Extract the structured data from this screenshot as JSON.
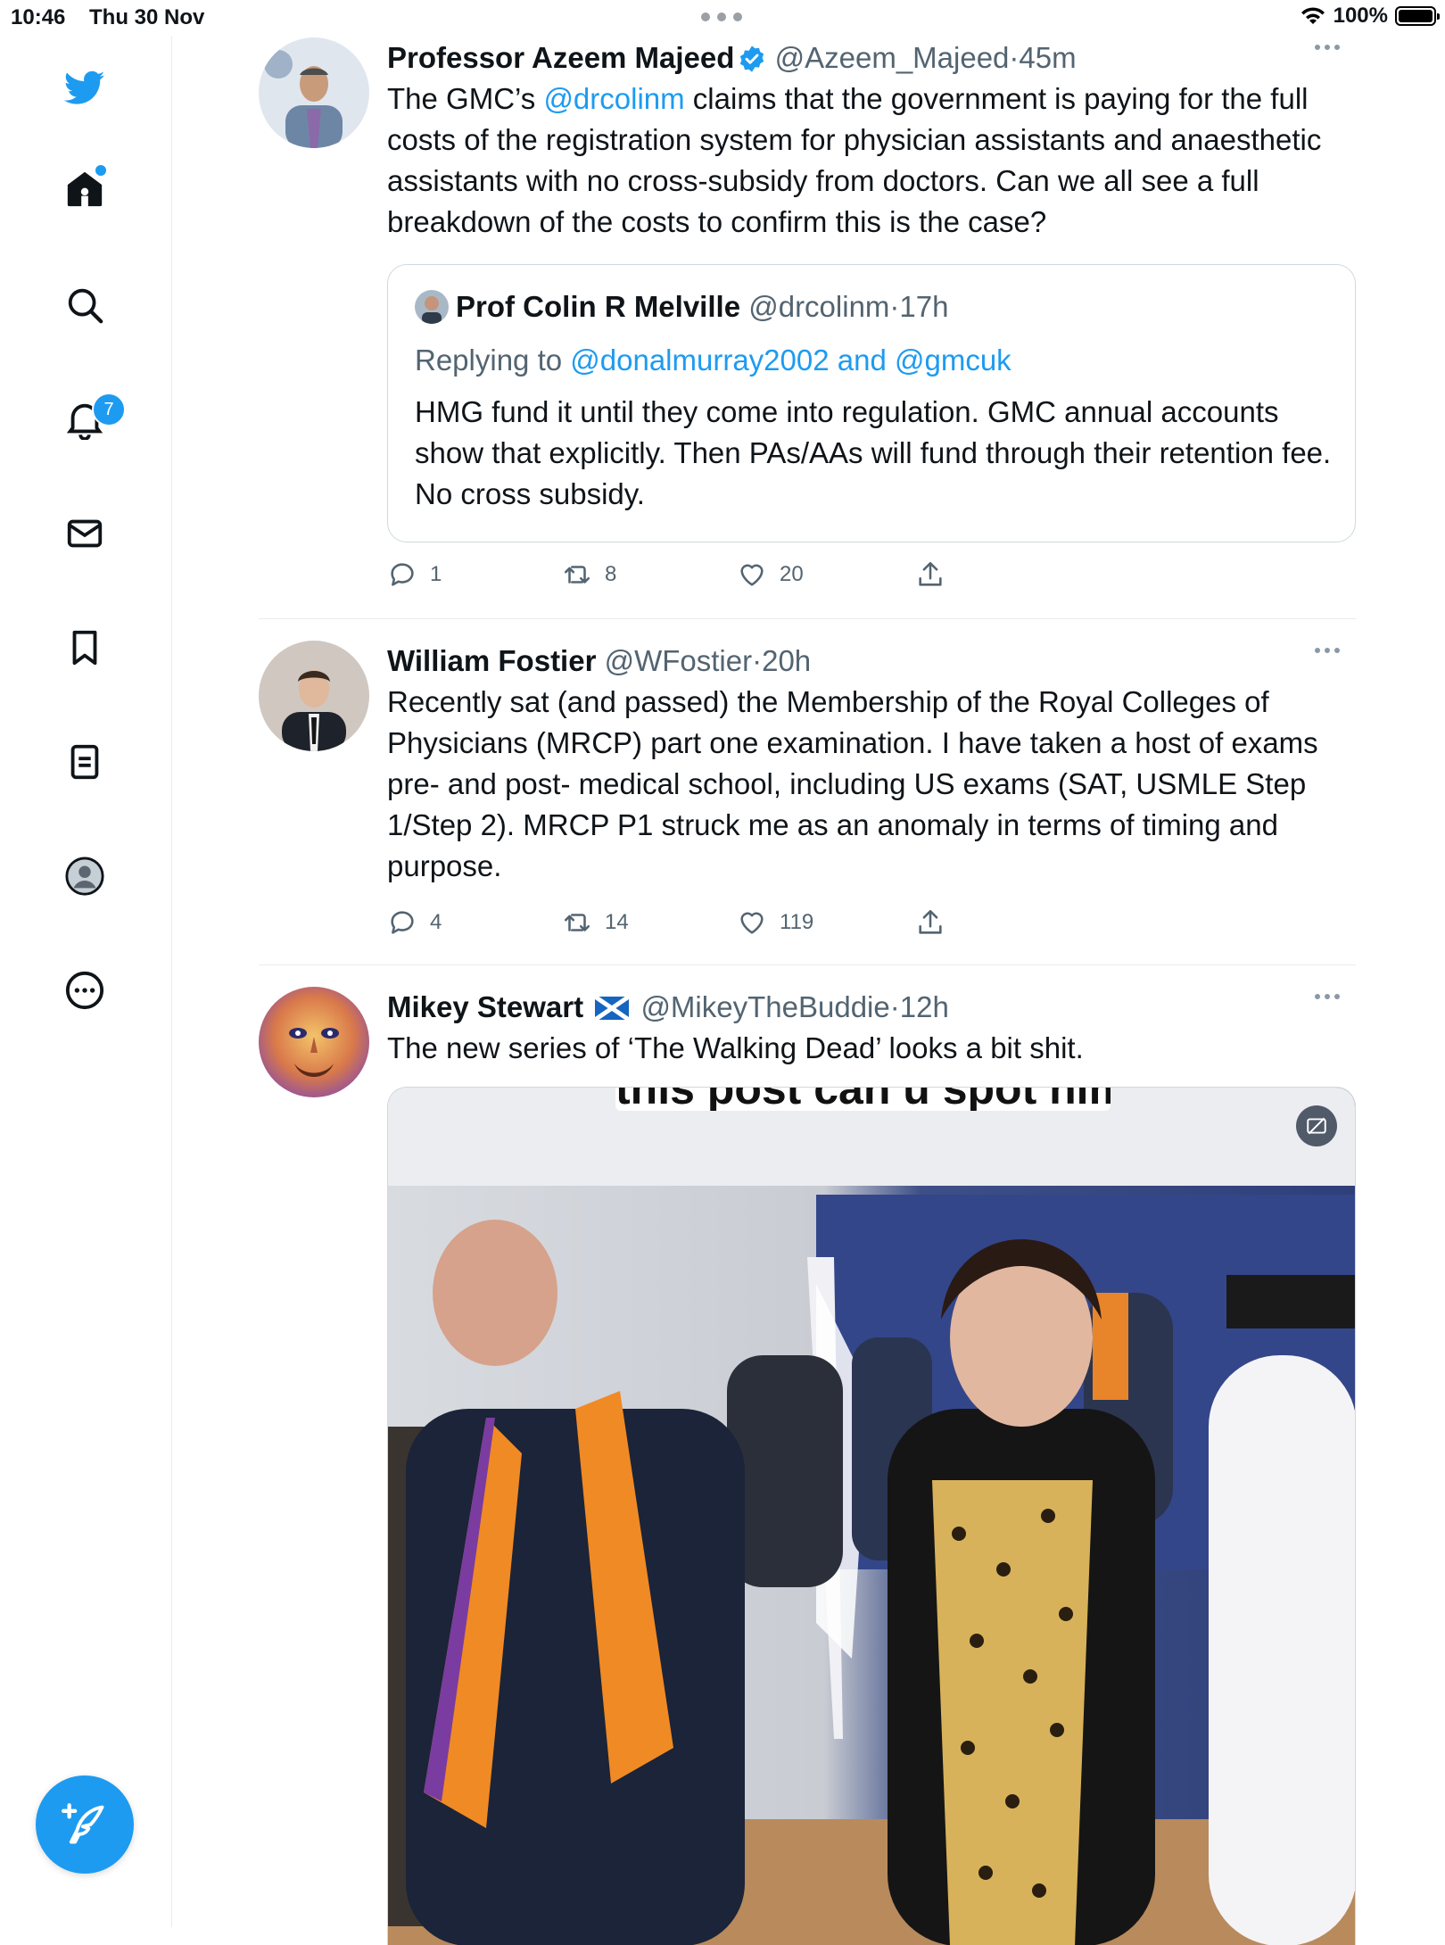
{
  "status_bar": {
    "time": "10:46",
    "date": "Thu 30 Nov",
    "battery": "100%"
  },
  "sidebar": {
    "items": [
      {
        "name": "twitter-logo-icon"
      },
      {
        "name": "home-icon"
      },
      {
        "name": "search-icon"
      },
      {
        "name": "notifications-icon",
        "badge": "7"
      },
      {
        "name": "messages-icon"
      },
      {
        "name": "bookmarks-icon"
      },
      {
        "name": "lists-icon"
      },
      {
        "name": "profile-icon"
      },
      {
        "name": "more-icon"
      }
    ],
    "compose_icon": "compose-tweet-icon"
  },
  "colors": {
    "accent": "#1d9bf0",
    "text": "#0f1419",
    "secondary": "#536471"
  },
  "tweets": [
    {
      "name": "Professor Azeem Majeed",
      "handle": "@Azeem_Majeed",
      "time": "45m",
      "text_parts": {
        "before": "The GMC’s ",
        "mention": "@drcolinm",
        "after": " claims that the government is paying for the full costs of the registration system for physician assistants and anaesthetic assistants with no cross-subsidy from doctors. Can we all see a full breakdown of the costs to confirm this is the case?"
      },
      "quote": {
        "name": "Prof Colin R Melville",
        "handle": "@drcolinm",
        "time": "17h",
        "replying_prefix": "Replying to ",
        "replying_to": "@donalmurray2002 and @gmcuk",
        "text": "HMG fund it until they come into regulation. GMC annual accounts show that explicitly. Then PAs/AAs will fund through their retention fee. No cross subsidy."
      },
      "replies": "1",
      "retweets": "8",
      "likes": "20"
    },
    {
      "name": "William Fostier",
      "handle": "@WFostier",
      "time": "20h",
      "text": "Recently sat (and passed) the Membership of the Royal Colleges of Physicians (MRCP) part one examination. I have taken a host of exams pre- and post- medical school, including US exams (SAT, USMLE Step 1/Step 2). MRCP P1 struck me as an anomaly in terms of timing and purpose.",
      "replies": "4",
      "retweets": "14",
      "likes": "119"
    },
    {
      "name": "Mikey Stewart",
      "flag": "🏴",
      "handle": "@MikeyTheBuddie",
      "time": "12h",
      "text": "The new series of ‘The Walking Dead’ looks a bit shit.",
      "media_caption": "this post can u spot him"
    }
  ],
  "separator": "·"
}
